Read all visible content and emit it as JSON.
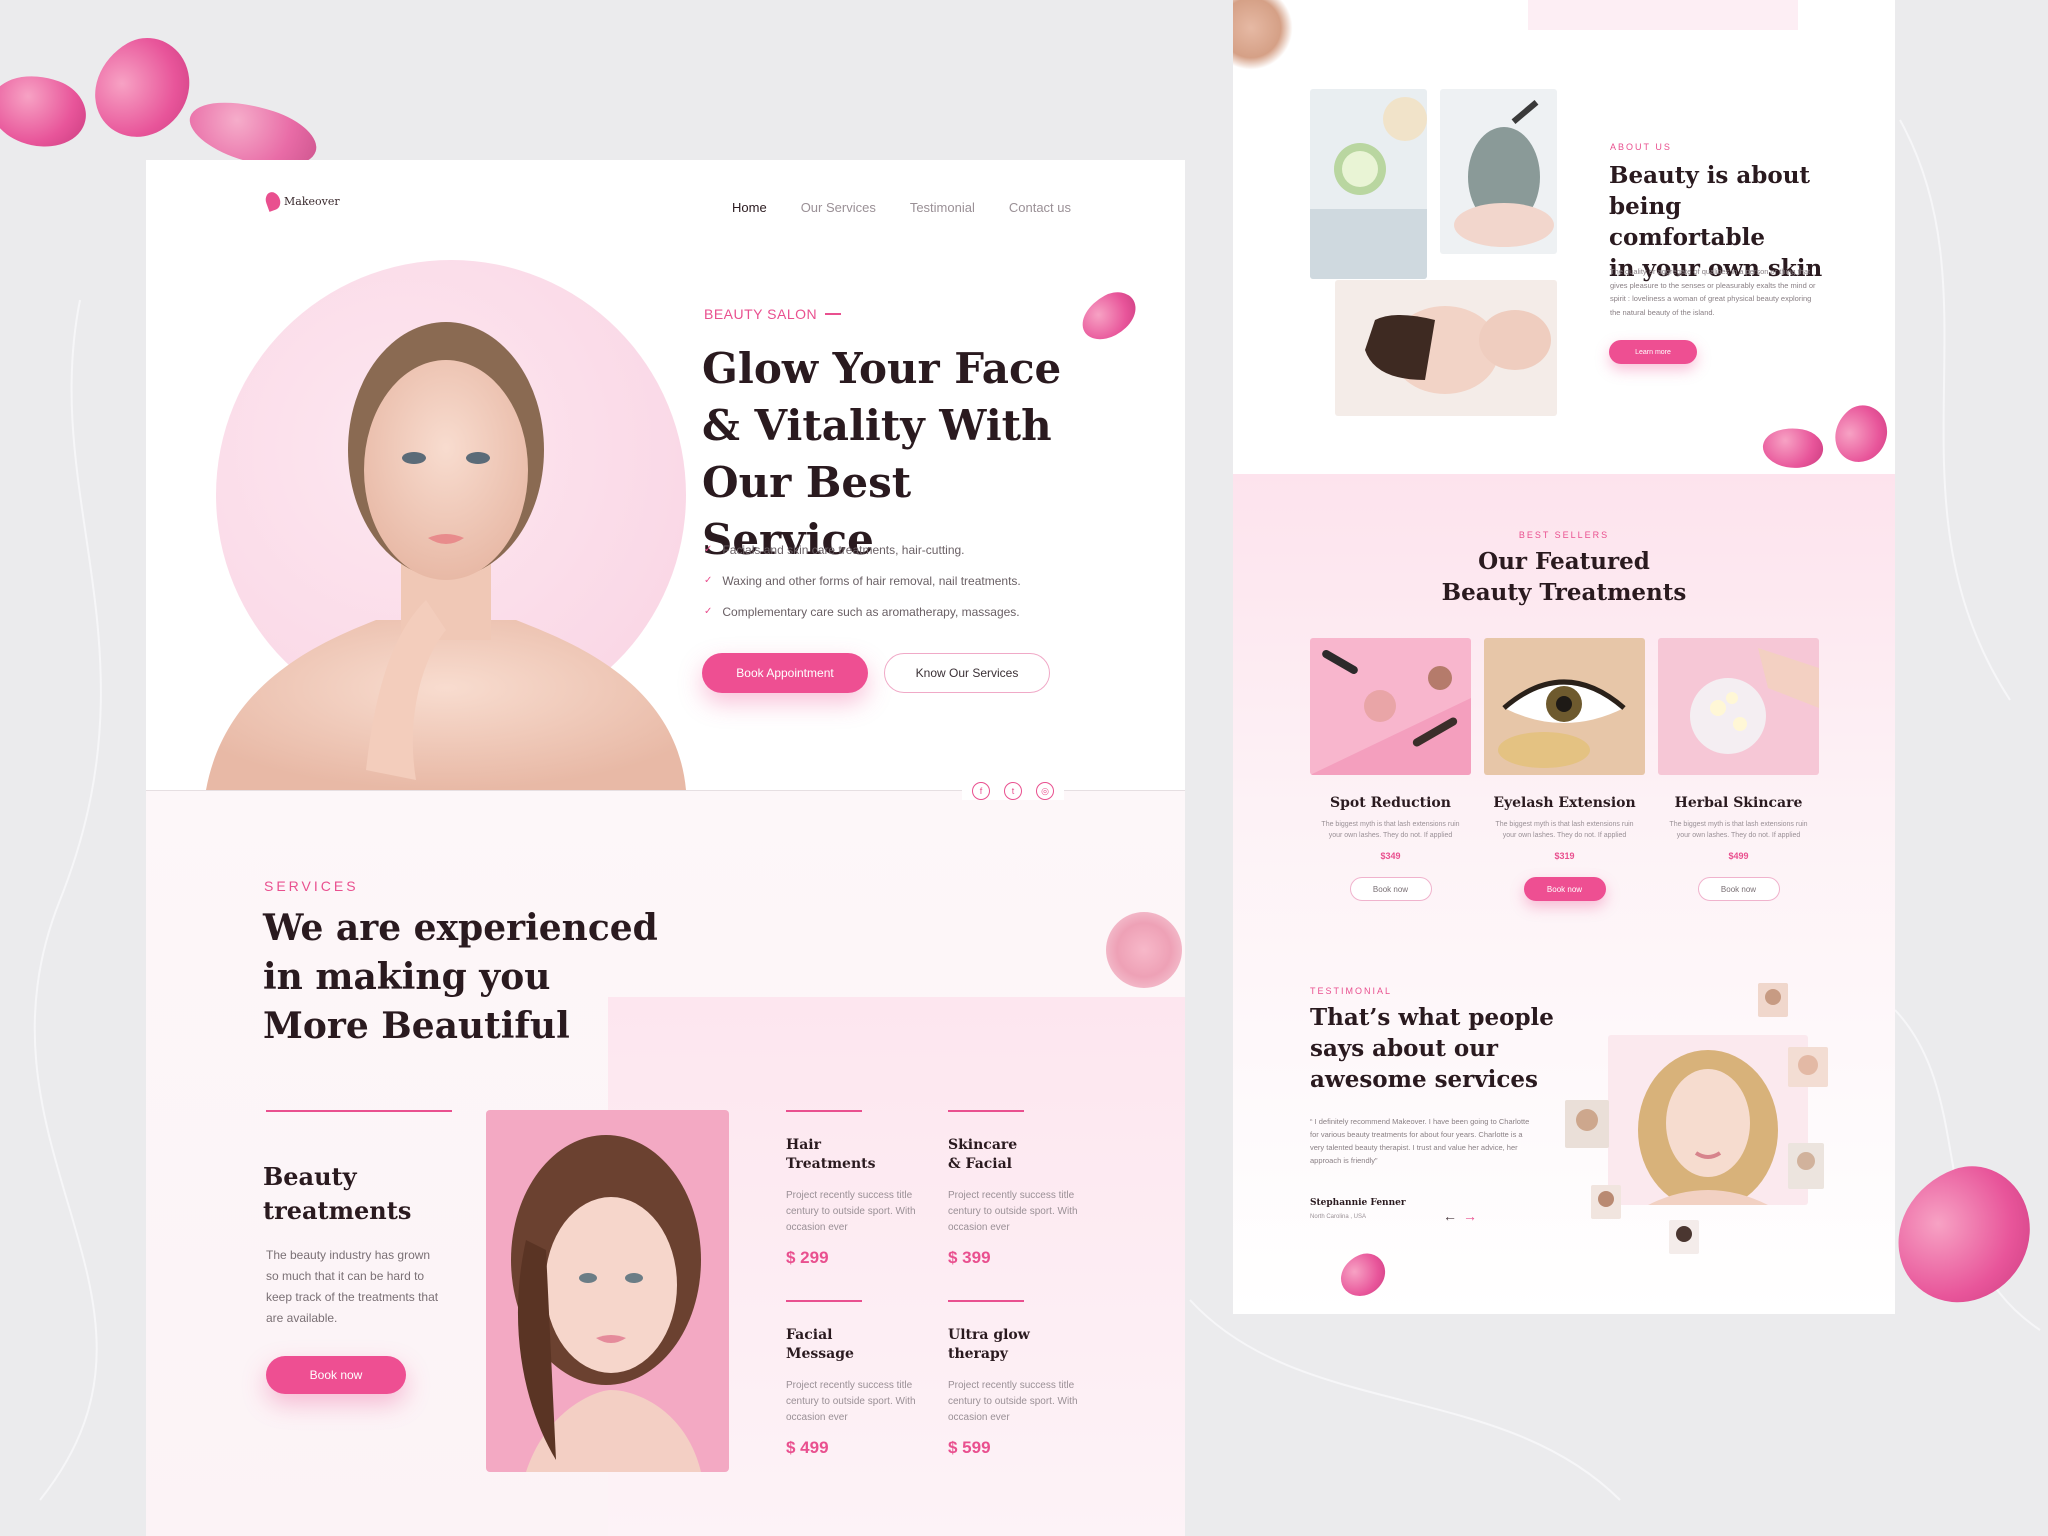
{
  "brand": {
    "name": "Makeover",
    "accent": "#ee4f92"
  },
  "nav": {
    "items": [
      {
        "label": "Home"
      },
      {
        "label": "Our Services"
      },
      {
        "label": "Testimonial"
      },
      {
        "label": "Contact us"
      }
    ]
  },
  "hero": {
    "kicker": "BEAUTY SALON",
    "title_lines": [
      "Glow Your Face",
      "& Vitality With",
      "Our Best Service"
    ],
    "features": [
      "Facials and skin care treatments, hair-cutting.",
      "Waxing and other forms of hair removal, nail treatments.",
      "Complementary care such as aromatherapy, massages."
    ],
    "primary_cta": "Book Appointment",
    "secondary_cta": "Know Our Services",
    "socials": [
      "facebook-icon",
      "twitter-icon",
      "instagram-icon"
    ]
  },
  "services": {
    "kicker": "SERVICES",
    "title_lines": [
      "We are experienced",
      "in making you",
      "More Beautiful"
    ],
    "feature_title_lines": [
      "Beauty",
      "treatments"
    ],
    "feature_desc": "The beauty industry has grown so much that it can be hard to keep track of the treatments that are available.",
    "cta": "Book now",
    "items": [
      {
        "title_lines": [
          "Hair",
          "Treatments"
        ],
        "desc": "Project recently success title century to outside sport. With occasion ever",
        "price": "$ 299"
      },
      {
        "title_lines": [
          "Skincare",
          "& Facial"
        ],
        "desc": "Project recently success title century to outside sport. With occasion ever",
        "price": "$ 399"
      },
      {
        "title_lines": [
          "Facial",
          "Message"
        ],
        "desc": "Project recently success title century to outside sport. With occasion ever",
        "price": "$ 499"
      },
      {
        "title_lines": [
          "Ultra glow",
          "therapy"
        ],
        "desc": "Project recently success title century to outside sport. With occasion ever",
        "price": "$ 599"
      }
    ]
  },
  "about": {
    "kicker": "ABOUT US",
    "title_lines": [
      "Beauty is about",
      "being comfortable",
      "in your own skin"
    ],
    "desc": "The quality or aggregate of qualities in a person or thing that gives pleasure to the senses or pleasurably exalts the mind or spirit : loveliness a woman of great physical beauty exploring the natural beauty of the island.",
    "cta": "Learn more"
  },
  "featured": {
    "kicker": "BEST SELLERS",
    "title_lines": [
      "Our Featured",
      "Beauty Treatments"
    ],
    "items": [
      {
        "title": "Spot Reduction",
        "desc": "The biggest myth is that lash extensions ruin your own lashes. They do not. If applied",
        "price": "$349",
        "cta": "Book now"
      },
      {
        "title": "Eyelash Extension",
        "desc": "The biggest myth is that lash extensions ruin your own lashes. They do not. If applied",
        "price": "$319",
        "cta": "Book now"
      },
      {
        "title": "Herbal Skincare",
        "desc": "The biggest myth is that lash extensions ruin your own lashes. They do not. If applied",
        "price": "$499",
        "cta": "Book now"
      }
    ]
  },
  "testimonial": {
    "kicker": "TESTIMONIAL",
    "title_lines": [
      "That’s what people",
      "says about our",
      "awesome services"
    ],
    "quote": "“ I definitely recommend Makeover. I have been going to Charlotte for various beauty treatments for about four years. Charlotte is a very talented beauty therapist. I trust and value her advice, her approach is friendly”",
    "name": "Stephannie Fenner",
    "location": "North Carolina , USA",
    "prev": "←",
    "next": "→"
  }
}
